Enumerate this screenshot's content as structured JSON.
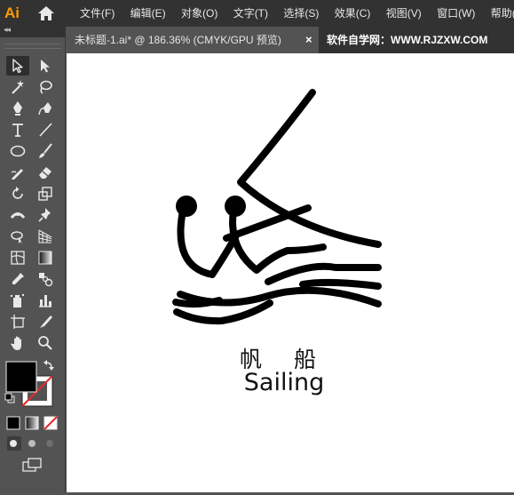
{
  "app": {
    "logo_text": "Ai"
  },
  "menus": [
    "文件(F)",
    "编辑(E)",
    "对象(O)",
    "文字(T)",
    "选择(S)",
    "效果(C)",
    "视图(V)",
    "窗口(W)",
    "帮助(H)"
  ],
  "panel": {
    "collapse_glyph": "◂◂"
  },
  "document_tab": {
    "title": "未标题-1.ai* @ 186.36% (CMYK/GPU 预览)",
    "close_glyph": "×"
  },
  "site_tab": {
    "label": "软件自学网：WWW.RJZXW.COM"
  },
  "tools": [
    "selection-tool",
    "direct-selection-tool",
    "magic-wand-tool",
    "lasso-tool",
    "pen-tool",
    "curvature-tool",
    "type-tool",
    "line-segment-tool",
    "ellipse-tool",
    "paintbrush-tool",
    "shaper-tool",
    "eraser-tool",
    "rotate-tool",
    "scale-tool",
    "width-tool",
    "puppet-warp-tool",
    "shape-builder-tool",
    "perspective-grid-tool",
    "mesh-tool",
    "gradient-tool",
    "eyedropper-tool",
    "blend-tool",
    "symbol-sprayer-tool",
    "column-graph-tool",
    "artboard-tool",
    "slice-tool",
    "hand-tool",
    "zoom-tool"
  ],
  "colors": {
    "fill": "#000000",
    "stroke": "#ffffff",
    "accent_none": "#e8282b",
    "logo": "#ff9a00"
  },
  "artwork": {
    "caption_cn": "帆 船",
    "caption_en": "Sailing"
  }
}
